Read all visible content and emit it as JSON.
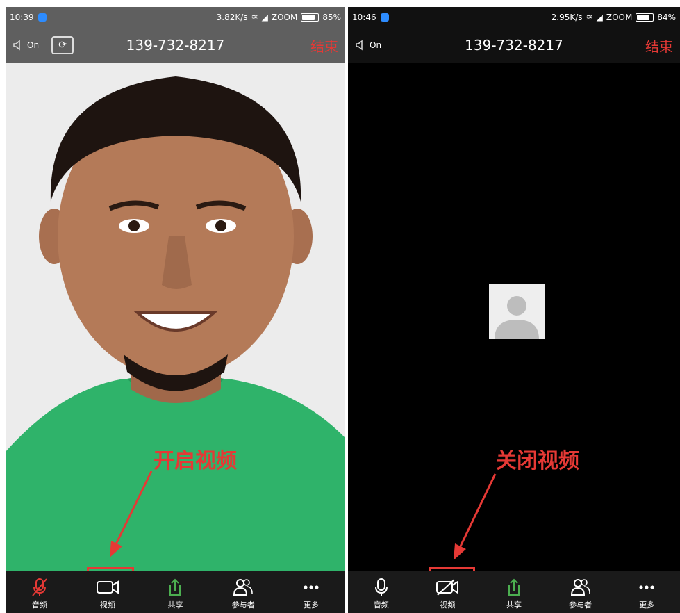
{
  "left_screen": {
    "status_bar": {
      "time": "10:39",
      "network_speed": "3.82K/s",
      "carrier": "ZOOM",
      "battery": "85%"
    },
    "header": {
      "audio_label": "On",
      "phone_number": "139-732-8217",
      "end_label": "结束"
    },
    "toolbar": {
      "audio": "音频",
      "video": "视频",
      "share": "共享",
      "participants": "参与者",
      "more": "更多"
    },
    "annotation": "开启视频"
  },
  "right_screen": {
    "status_bar": {
      "time": "10:46",
      "network_speed": "2.95K/s",
      "carrier": "ZOOM",
      "battery": "84%"
    },
    "header": {
      "audio_label": "On",
      "phone_number": "139-732-8217",
      "end_label": "结束"
    },
    "toolbar": {
      "audio": "音频",
      "video": "视频",
      "share": "共享",
      "participants": "参与者",
      "more": "更多"
    },
    "annotation": "关闭视频"
  },
  "colors": {
    "accent_red": "#e53935",
    "share_green": "#4caf50",
    "shirt_green": "#2fb36a",
    "toolbar_bg": "#1a1a1a"
  },
  "icons": [
    "speaker-icon",
    "camera-flip-icon",
    "microphone-muted-icon",
    "video-camera-icon",
    "video-off-icon",
    "share-icon",
    "participants-icon",
    "more-icon",
    "avatar-placeholder-icon"
  ]
}
